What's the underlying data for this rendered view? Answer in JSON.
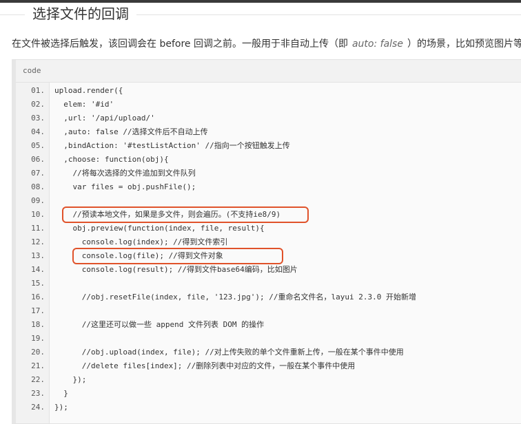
{
  "section": {
    "title": "选择文件的回调"
  },
  "description": {
    "before": "在文件被选择后触发，该回调会在 before 回调之前。一般用于非自动上传（即",
    "code": "auto: false",
    "after": "）的场景，比如预览图片等。"
  },
  "code_block": {
    "label": "code",
    "lines": [
      {
        "num": "01.",
        "text": "upload.render({"
      },
      {
        "num": "02.",
        "text": "  elem: '#id'"
      },
      {
        "num": "03.",
        "text": "  ,url: '/api/upload/'"
      },
      {
        "num": "04.",
        "text": "  ,auto: false //选择文件后不自动上传"
      },
      {
        "num": "05.",
        "text": "  ,bindAction: '#testListAction' //指向一个按钮触发上传"
      },
      {
        "num": "06.",
        "text": "  ,choose: function(obj){"
      },
      {
        "num": "07.",
        "text": "    //将每次选择的文件追加到文件队列"
      },
      {
        "num": "08.",
        "text": "    var files = obj.pushFile();"
      },
      {
        "num": "09.",
        "text": ""
      },
      {
        "num": "10.",
        "text": "    //预读本地文件，如果是多文件，则会遍历。(不支持ie8/9)"
      },
      {
        "num": "11.",
        "text": "    obj.preview(function(index, file, result){"
      },
      {
        "num": "12.",
        "text": "      console.log(index); //得到文件索引"
      },
      {
        "num": "13.",
        "text": "      console.log(file); //得到文件对象"
      },
      {
        "num": "14.",
        "text": "      console.log(result); //得到文件base64编码，比如图片"
      },
      {
        "num": "15.",
        "text": ""
      },
      {
        "num": "16.",
        "text": "      //obj.resetFile(index, file, '123.jpg'); //重命名文件名，layui 2.3.0 开始新增"
      },
      {
        "num": "17.",
        "text": ""
      },
      {
        "num": "18.",
        "text": "      //这里还可以做一些 append 文件列表 DOM 的操作"
      },
      {
        "num": "19.",
        "text": ""
      },
      {
        "num": "20.",
        "text": "      //obj.upload(index, file); //对上传失败的单个文件重新上传，一般在某个事件中使用"
      },
      {
        "num": "21.",
        "text": "      //delete files[index]; //删除列表中对应的文件，一般在某个事件中使用"
      },
      {
        "num": "22.",
        "text": "    });"
      },
      {
        "num": "23.",
        "text": "  }"
      },
      {
        "num": "24.",
        "text": "});"
      }
    ]
  },
  "highlight_color": "#e0522a"
}
